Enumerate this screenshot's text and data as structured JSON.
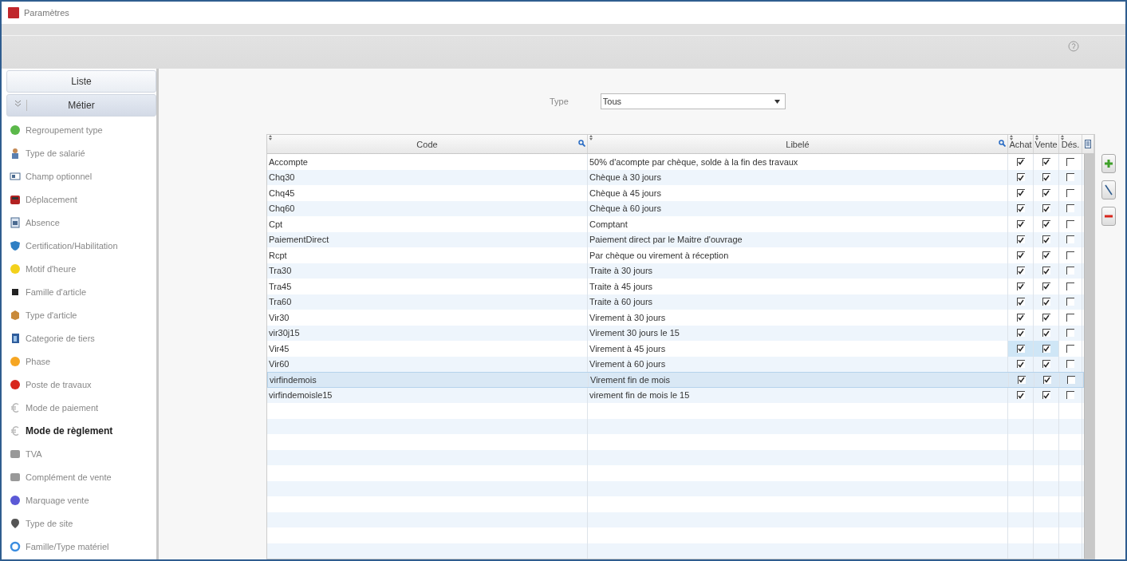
{
  "window": {
    "title": "Paramètres"
  },
  "sidebar": {
    "sections": [
      {
        "label": "Liste",
        "expanded": false
      },
      {
        "label": "Métier",
        "expanded": true
      }
    ],
    "items": [
      {
        "label": "Regroupement type",
        "selected": false
      },
      {
        "label": "Type de salarié",
        "selected": false
      },
      {
        "label": "Champ optionnel",
        "selected": false
      },
      {
        "label": "Déplacement",
        "selected": false
      },
      {
        "label": "Absence",
        "selected": false
      },
      {
        "label": "Certification/Habilitation",
        "selected": false
      },
      {
        "label": "Motif d'heure",
        "selected": false
      },
      {
        "label": "Famille d'article",
        "selected": false
      },
      {
        "label": "Type d'article",
        "selected": false
      },
      {
        "label": "Categorie de tiers",
        "selected": false
      },
      {
        "label": "Phase",
        "selected": false
      },
      {
        "label": "Poste de travaux",
        "selected": false
      },
      {
        "label": "Mode de paiement",
        "selected": false
      },
      {
        "label": "Mode de règlement",
        "selected": true
      },
      {
        "label": "TVA",
        "selected": false
      },
      {
        "label": "Complément de vente",
        "selected": false
      },
      {
        "label": "Marquage vente",
        "selected": false
      },
      {
        "label": "Type de site",
        "selected": false
      },
      {
        "label": "Famille/Type matériel",
        "selected": false
      }
    ]
  },
  "filter": {
    "label": "Type",
    "value": "Tous"
  },
  "table": {
    "columns": [
      "Code",
      "Libelé",
      "Achat",
      "Vente",
      "Dés."
    ],
    "rows": [
      {
        "code": "Accompte",
        "label": "50% d'acompte par chèque, solde à la fin des travaux",
        "achat": true,
        "vente": true,
        "des": false,
        "selected": false,
        "focused": false
      },
      {
        "code": "Chq30",
        "label": "Chèque à 30 jours",
        "achat": true,
        "vente": true,
        "des": false,
        "selected": false,
        "focused": false
      },
      {
        "code": "Chq45",
        "label": "Chèque à 45 jours",
        "achat": true,
        "vente": true,
        "des": false,
        "selected": false,
        "focused": false
      },
      {
        "code": "Chq60",
        "label": "Chèque à 60 jours",
        "achat": true,
        "vente": true,
        "des": false,
        "selected": false,
        "focused": false
      },
      {
        "code": "Cpt",
        "label": "Comptant",
        "achat": true,
        "vente": true,
        "des": false,
        "selected": false,
        "focused": false
      },
      {
        "code": "PaiementDirect",
        "label": "Paiement direct par le Maitre d'ouvrage",
        "achat": true,
        "vente": true,
        "des": false,
        "selected": false,
        "focused": false
      },
      {
        "code": "Rcpt",
        "label": "Par chèque ou virement à réception",
        "achat": true,
        "vente": true,
        "des": false,
        "selected": false,
        "focused": false
      },
      {
        "code": "Tra30",
        "label": "Traite à 30 jours",
        "achat": true,
        "vente": true,
        "des": false,
        "selected": false,
        "focused": false
      },
      {
        "code": "Tra45",
        "label": "Traite à 45 jours",
        "achat": true,
        "vente": true,
        "des": false,
        "selected": false,
        "focused": false
      },
      {
        "code": "Tra60",
        "label": "Traite à 60 jours",
        "achat": true,
        "vente": true,
        "des": false,
        "selected": false,
        "focused": false
      },
      {
        "code": "Vir30",
        "label": "Virement à 30 jours",
        "achat": true,
        "vente": true,
        "des": false,
        "selected": false,
        "focused": false
      },
      {
        "code": "vir30j15",
        "label": "Virement 30 jours le 15",
        "achat": true,
        "vente": true,
        "des": false,
        "selected": false,
        "focused": false
      },
      {
        "code": "Vir45",
        "label": "Virement à 45 jours",
        "achat": true,
        "vente": true,
        "des": false,
        "selected": false,
        "focused": true
      },
      {
        "code": "Vir60",
        "label": "Virement à 60 jours",
        "achat": true,
        "vente": true,
        "des": false,
        "selected": false,
        "focused": false
      },
      {
        "code": "virfindemois",
        "label": "Virement fin de mois",
        "achat": true,
        "vente": true,
        "des": false,
        "selected": true,
        "focused": false
      },
      {
        "code": "virfindemoisle15",
        "label": "virement fin de mois le 15",
        "achat": true,
        "vente": true,
        "des": false,
        "selected": false,
        "focused": false
      }
    ]
  }
}
